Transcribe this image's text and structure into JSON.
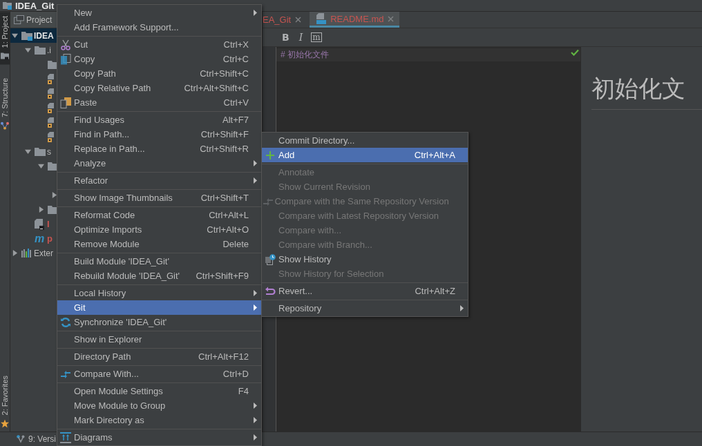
{
  "window": {
    "title": "IDEA_Git"
  },
  "left_tool_strip": {
    "top": [
      {
        "label": "1: Project",
        "selected": true,
        "kind": "project"
      },
      {
        "label": "7: Structure",
        "selected": false,
        "kind": "structure"
      }
    ],
    "bottom": [
      {
        "label": "2: Favorites",
        "selected": false,
        "kind": "favorites"
      }
    ]
  },
  "project_panel": {
    "title": "Project",
    "tree": [
      {
        "label": "IDEA",
        "kind": "module",
        "selected": true,
        "expanded": true,
        "children": [
          {
            "label": ".i",
            "kind": "folder",
            "selected": false,
            "expanded": true,
            "children": [
              {
                "kind": "folder",
                "selected": false
              },
              {
                "kind": "locked-file",
                "selected": false
              },
              {
                "kind": "locked-file",
                "selected": false
              },
              {
                "kind": "locked-file",
                "selected": false
              },
              {
                "kind": "locked-file",
                "selected": false
              },
              {
                "kind": "locked-file",
                "selected": false
              }
            ]
          },
          {
            "label": "s",
            "kind": "folder",
            "selected": false,
            "expanded": true,
            "children": [
              {
                "kind": "folder",
                "selected": false,
                "expanded": true,
                "children": [
                  {
                    "selected": false
                  },
                  {
                    "selected": false,
                    "expanded": false
                  }
                ]
              },
              {
                "kind": "folder",
                "selected": false,
                "expanded": false
              }
            ]
          },
          {
            "label": "I",
            "kind": "iml",
            "selected": false,
            "color": "#c75450"
          },
          {
            "label": "p",
            "kind": "maven",
            "glyph": "m",
            "selected": false,
            "color": "#c75450"
          }
        ]
      },
      {
        "label": "Exter",
        "kind": "libraries",
        "selected": false,
        "expanded": false
      }
    ]
  },
  "editor": {
    "tabs": [
      {
        "label": "EA_Git",
        "selected": false,
        "kind": "plain",
        "color": "#c75450"
      },
      {
        "label": "README.md",
        "selected": true,
        "kind": "markdown",
        "color": "#c75450"
      }
    ],
    "toolbar": [
      {
        "label": "B",
        "kind": "bold"
      },
      {
        "label": "I",
        "kind": "italic"
      },
      {
        "label": "m",
        "kind": "code"
      }
    ],
    "lines": [
      "# 初始化文件"
    ],
    "preview": {
      "heading": "初始化文"
    }
  },
  "context_menu": {
    "groups": [
      [
        {
          "label": "New",
          "submenu": true,
          "selected": false
        },
        {
          "label": "Add Framework Support...",
          "selected": false
        }
      ],
      [
        {
          "label": "Cut",
          "shortcut": "Ctrl+X",
          "kind": "cut",
          "selected": false
        },
        {
          "label": "Copy",
          "shortcut": "Ctrl+C",
          "kind": "copy",
          "selected": false
        },
        {
          "label": "Copy Path",
          "shortcut": "Ctrl+Shift+C",
          "selected": false
        },
        {
          "label": "Copy Relative Path",
          "shortcut": "Ctrl+Alt+Shift+C",
          "selected": false
        },
        {
          "label": "Paste",
          "shortcut": "Ctrl+V",
          "kind": "paste",
          "selected": false
        }
      ],
      [
        {
          "label": "Find Usages",
          "shortcut": "Alt+F7",
          "selected": false
        },
        {
          "label": "Find in Path...",
          "shortcut": "Ctrl+Shift+F",
          "selected": false
        },
        {
          "label": "Replace in Path...",
          "shortcut": "Ctrl+Shift+R",
          "selected": false
        },
        {
          "label": "Analyze",
          "submenu": true,
          "selected": false
        }
      ],
      [
        {
          "label": "Refactor",
          "submenu": true,
          "selected": false
        }
      ],
      [
        {
          "label": "Show Image Thumbnails",
          "shortcut": "Ctrl+Shift+T",
          "selected": false
        }
      ],
      [
        {
          "label": "Reformat Code",
          "shortcut": "Ctrl+Alt+L",
          "selected": false
        },
        {
          "label": "Optimize Imports",
          "shortcut": "Ctrl+Alt+O",
          "selected": false
        },
        {
          "label": "Remove Module",
          "shortcut": "Delete",
          "selected": false
        }
      ],
      [
        {
          "label": "Build Module 'IDEA_Git'",
          "selected": false
        },
        {
          "label": "Rebuild Module 'IDEA_Git'",
          "shortcut": "Ctrl+Shift+F9",
          "selected": false
        }
      ],
      [
        {
          "label": "Local History",
          "submenu": true,
          "selected": false
        },
        {
          "label": "Git",
          "submenu": true,
          "selected": true
        },
        {
          "label": "Synchronize 'IDEA_Git'",
          "kind": "sync",
          "selected": false
        }
      ],
      [
        {
          "label": "Show in Explorer",
          "selected": false
        }
      ],
      [
        {
          "label": "Directory Path",
          "shortcut": "Ctrl+Alt+F12",
          "selected": false
        }
      ],
      [
        {
          "label": "Compare With...",
          "shortcut": "Ctrl+D",
          "kind": "compare",
          "selected": false
        }
      ],
      [
        {
          "label": "Open Module Settings",
          "shortcut": "F4",
          "selected": false
        },
        {
          "label": "Move Module to Group",
          "submenu": true,
          "selected": false
        },
        {
          "label": "Mark Directory as",
          "submenu": true,
          "selected": false
        }
      ],
      [
        {
          "label": "Diagrams",
          "submenu": true,
          "kind": "diagram",
          "selected": false
        }
      ]
    ]
  },
  "git_submenu": {
    "groups": [
      [
        {
          "label": "Commit Directory...",
          "selected": false,
          "disabled": false
        },
        {
          "label": "Add",
          "shortcut": "Ctrl+Alt+A",
          "kind": "add",
          "selected": true,
          "disabled": false
        }
      ],
      [
        {
          "label": "Annotate",
          "selected": false,
          "disabled": true
        },
        {
          "label": "Show Current Revision",
          "selected": false,
          "disabled": true
        },
        {
          "label": "Compare with the Same Repository Version",
          "kind": "compare",
          "selected": false,
          "disabled": true
        },
        {
          "label": "Compare with Latest Repository Version",
          "selected": false,
          "disabled": true
        },
        {
          "label": "Compare with...",
          "selected": false,
          "disabled": true
        },
        {
          "label": "Compare with Branch...",
          "selected": false,
          "disabled": true
        },
        {
          "label": "Show History",
          "kind": "history",
          "selected": false,
          "disabled": false
        },
        {
          "label": "Show History for Selection",
          "selected": false,
          "disabled": true
        }
      ],
      [
        {
          "label": "Revert...",
          "shortcut": "Ctrl+Alt+Z",
          "kind": "revert",
          "selected": false,
          "disabled": false
        }
      ],
      [
        {
          "label": "Repository",
          "submenu": true,
          "selected": false,
          "disabled": false
        }
      ]
    ]
  },
  "status_bar": {
    "tool_windows": [
      {
        "label": "9: Versi",
        "kind": "version-control"
      }
    ]
  }
}
